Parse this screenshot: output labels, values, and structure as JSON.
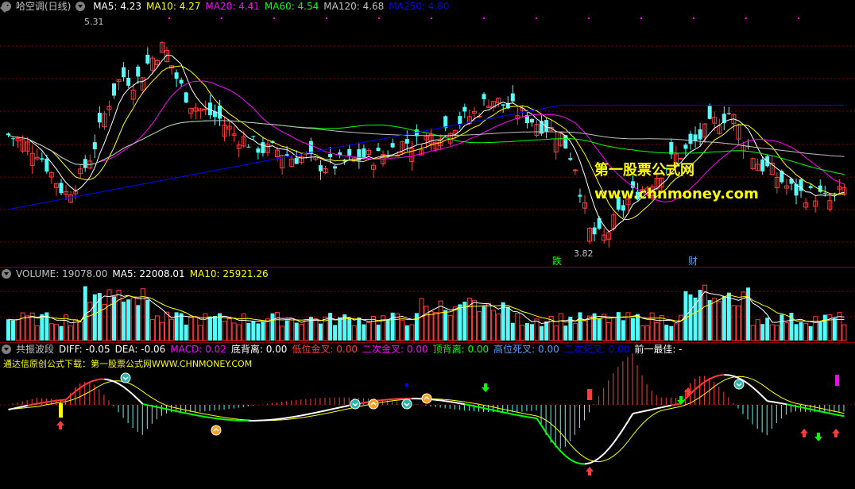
{
  "colors": {
    "up": "#ff3c3c",
    "down": "#54fcfc",
    "ma5": "#ffffff",
    "ma10": "#ffff00",
    "ma20": "#ff00ff",
    "ma60": "#00ff00",
    "ma120": "#c0c0c0",
    "ma250": "#0000ff",
    "grid": "#8b0000"
  },
  "main": {
    "title": "哈空调(日线)",
    "ma": [
      {
        "label": "MA5: 4.23",
        "color": "#ffffff"
      },
      {
        "label": "MA10: 4.27",
        "color": "#ffff00"
      },
      {
        "label": "MA20: 4.41",
        "color": "#ff00ff"
      },
      {
        "label": "MA60: 4.54",
        "color": "#00ff00"
      },
      {
        "label": "MA120: 4.68",
        "color": "#c0c0c0"
      },
      {
        "label": "MA250: 4.80",
        "color": "#0000ff"
      }
    ],
    "high_label": "5.31",
    "low_label": "3.82",
    "event1": "跌",
    "event2": "财",
    "watermark1": "第一股票公式网",
    "watermark2": "www.chnmoney.com"
  },
  "volume": {
    "labels": [
      {
        "label": "VOLUME: 19078.00",
        "color": "#c0c0c0"
      },
      {
        "label": "MA5: 22008.01",
        "color": "#ffffff"
      },
      {
        "label": "MA10: 25921.26",
        "color": "#ffff00"
      }
    ]
  },
  "macd": {
    "labels": [
      {
        "label": "共振波段",
        "color": "#c0c0c0"
      },
      {
        "label": "DIFF: -0.05",
        "color": "#ffffff"
      },
      {
        "label": "DEA: -0.06",
        "color": "#ffffff"
      },
      {
        "label": "MACD: 0.02",
        "color": "#ff00ff"
      },
      {
        "label": "底背离: 0.00",
        "color": "#ffffff"
      },
      {
        "label": "低位金叉: 0.00",
        "color": "#ff3c3c"
      },
      {
        "label": "二次金叉: 0.00",
        "color": "#ff00ff"
      },
      {
        "label": "顶背离: 0.00",
        "color": "#00ff00"
      },
      {
        "label": "高位死叉: 0.00",
        "color": "#54a0ff"
      },
      {
        "label": "二次死叉: 0.00",
        "color": "#0000ff"
      },
      {
        "label": "前一最佳: -",
        "color": "#ffffff"
      }
    ],
    "promo": "通达信原创公式下载：第一股票公式网WWW.CHNMONEY.COM"
  },
  "chart_data": {
    "type": "candlestick",
    "title": "哈空调(日线)",
    "ylabel": "",
    "xlabel": "",
    "high": 5.31,
    "low": 3.82,
    "close_path": [
      4.6,
      4.55,
      4.5,
      4.35,
      4.2,
      4.3,
      4.5,
      4.8,
      5.0,
      4.95,
      5.1,
      5.2,
      4.95,
      4.8,
      4.75,
      4.7,
      4.6,
      4.55,
      4.5,
      4.5,
      4.45,
      4.45,
      4.4,
      4.4,
      4.42,
      4.45,
      4.45,
      4.5,
      4.55,
      4.55,
      4.6,
      4.65,
      4.7,
      4.75,
      4.85,
      4.8,
      4.75,
      4.7,
      4.65,
      4.6,
      4.4,
      3.95,
      3.9,
      4.05,
      4.2,
      4.25,
      4.35,
      4.45,
      4.5,
      4.6,
      4.7,
      4.75,
      4.55,
      4.4,
      4.35,
      4.25,
      4.2,
      4.2,
      4.15,
      4.23
    ]
  }
}
